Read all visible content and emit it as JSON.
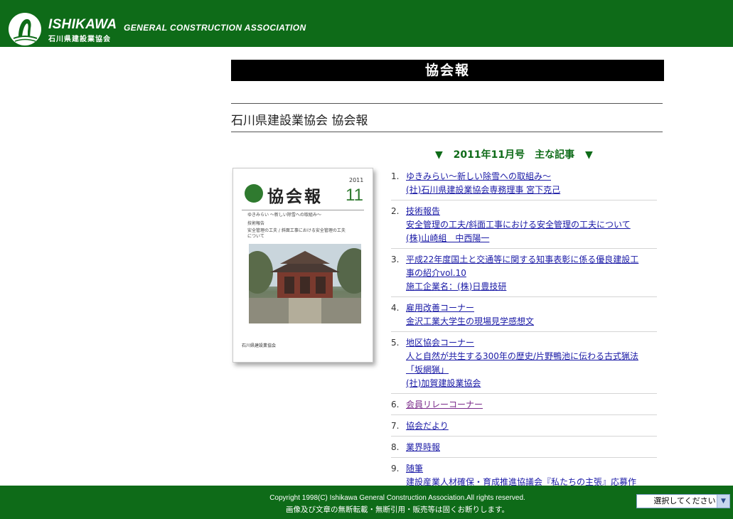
{
  "header": {
    "brand_main": "ISHIKAWA",
    "brand_sub": "GENERAL CONSTRUCTION ASSOCIATION",
    "brand_jp": "石川県建設業協会",
    "logo_icon": "association-logo-icon"
  },
  "page": {
    "title": "協会報",
    "subtitle": "石川県建設業協会 協会報"
  },
  "cover": {
    "title": "協会報",
    "year": "2011",
    "issue": "11",
    "lines": [
      "ゆきみらい ～新しい除雪への取組み～",
      "技術報告",
      "安全管理の工夫 / 斜面工事における安全管理の工夫",
      "について",
      "石川県建設業協会"
    ]
  },
  "section": {
    "heading": "2011年11月号　主な記事",
    "marker_icon": "triangle-down-icon"
  },
  "articles": [
    {
      "num": "1.",
      "lines": [
        "ゆきみらい～新しい除雪への取組み～",
        "(社)石川県建設業協会専務理事 宮下克己"
      ],
      "visited": false
    },
    {
      "num": "2.",
      "lines": [
        "技術報告",
        "安全管理の工夫/斜面工事における安全管理の工夫について",
        "(株)山崎組　中西陽一"
      ],
      "visited": false
    },
    {
      "num": "3.",
      "lines": [
        "平成22年度国土と交通等に関する知事表彰に係る優良建設工",
        "事の紹介vol.10",
        "施工企業名：(株)日豊技研"
      ],
      "visited": false
    },
    {
      "num": "4.",
      "lines": [
        "雇用改善コーナー",
        "金沢工業大学生の現場見学感想文"
      ],
      "visited": false
    },
    {
      "num": "5.",
      "lines": [
        "地区協会コーナー",
        "人と自然が共生する300年の歴史/片野鴨池に伝わる古式猟法",
        "「坂網猟」",
        "(社)加賀建設業協会"
      ],
      "visited": false
    },
    {
      "num": "6.",
      "lines": [
        "会員リレーコーナー"
      ],
      "visited": true
    },
    {
      "num": "7.",
      "lines": [
        "協会だより"
      ],
      "visited": false
    },
    {
      "num": "8.",
      "lines": [
        "業界時報"
      ],
      "visited": false
    },
    {
      "num": "9.",
      "lines": [
        "随筆",
        "建設産業人材確保・育成推進協議会『私たちの主張』応募作"
      ],
      "visited": false
    }
  ],
  "footer": {
    "copyright": "Copyright 1998(C) Ishikawa General Construction Association.All rights reserved.",
    "notice": "画像及び文章の無断転載・無断引用・販売等は固くお断りします。",
    "select_value": "選択してください"
  },
  "colors": {
    "brand_green": "#0e6b18",
    "link": "#1a1aa6",
    "visited_link": "#7a2a8a",
    "title_bar": "#000000"
  }
}
